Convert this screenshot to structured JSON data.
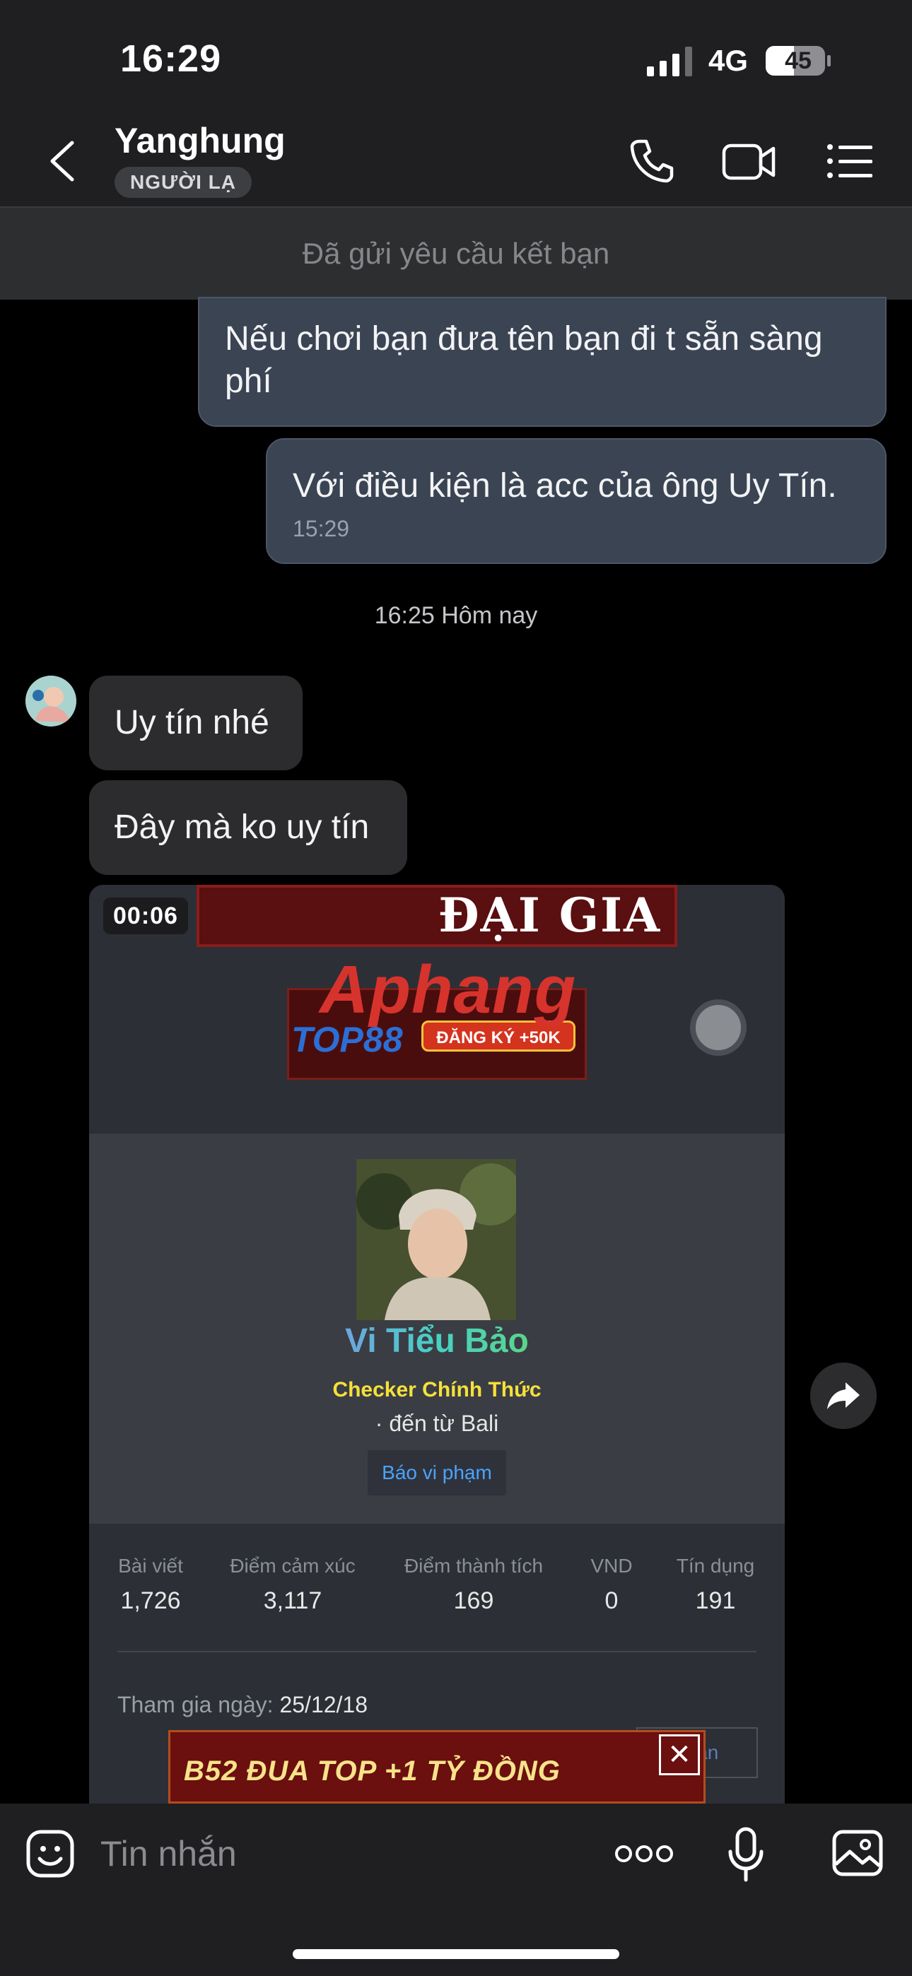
{
  "status_bar": {
    "time": "16:29",
    "network": "4G",
    "battery": "45"
  },
  "header": {
    "contact_name": "Yanghung",
    "badge": "NGƯỜI LẠ"
  },
  "friend_request": {
    "text": "Đã gửi yêu cầu kết bạn"
  },
  "messages": [
    {
      "direction": "out",
      "text": "Nếu chơi bạn đưa tên bạn đi t sẵn sàng phí"
    },
    {
      "direction": "out",
      "text": "Với điều kiện là acc của ông Uy Tín.",
      "time": "15:29"
    },
    {
      "direction": "in",
      "text": "Uy tín nhé"
    },
    {
      "direction": "in",
      "text": "Đây mà ko uy tín"
    }
  ],
  "date_separator": "16:25 Hôm nay",
  "video": {
    "duration": "00:06",
    "top_banner": "ĐẠI GIA",
    "watermark": "Aphang",
    "ad_logo": "TOP88",
    "ad_button": "ĐĂNG KÝ +50K",
    "profile": {
      "username": "Vi Tiểu Bảo",
      "role": "Checker Chính Thức",
      "origin": "· đến từ Bali",
      "report_button": "Báo vi phạm",
      "stats": [
        {
          "label": "Bài viết",
          "value": "1,726"
        },
        {
          "label": "Điểm cảm xúc",
          "value": "3,117"
        },
        {
          "label": "Điểm thành tích",
          "value": "169"
        },
        {
          "label": "VND",
          "value": "0"
        },
        {
          "label": "Tín dụng",
          "value": "191"
        }
      ],
      "join_label": "Tham gia ngày:",
      "join_date": "25/12/18",
      "partial_button": "chặn"
    },
    "bottom_ad": "B52  ĐUA TOP +1 TỶ ĐỒNG",
    "bottom_ad_close": "✕"
  },
  "composer": {
    "placeholder": "Tin nhắn"
  },
  "colors": {
    "background": "#000000",
    "bar": "#1f1f21",
    "outgoing_bubble": "#3b4453",
    "incoming_bubble": "#2c2c2e"
  },
  "icons": [
    "chevron-left-icon",
    "phone-icon",
    "video-camera-icon",
    "menu-list-icon",
    "share-forward-icon",
    "sticker-icon",
    "more-icon",
    "microphone-icon",
    "gallery-icon"
  ]
}
